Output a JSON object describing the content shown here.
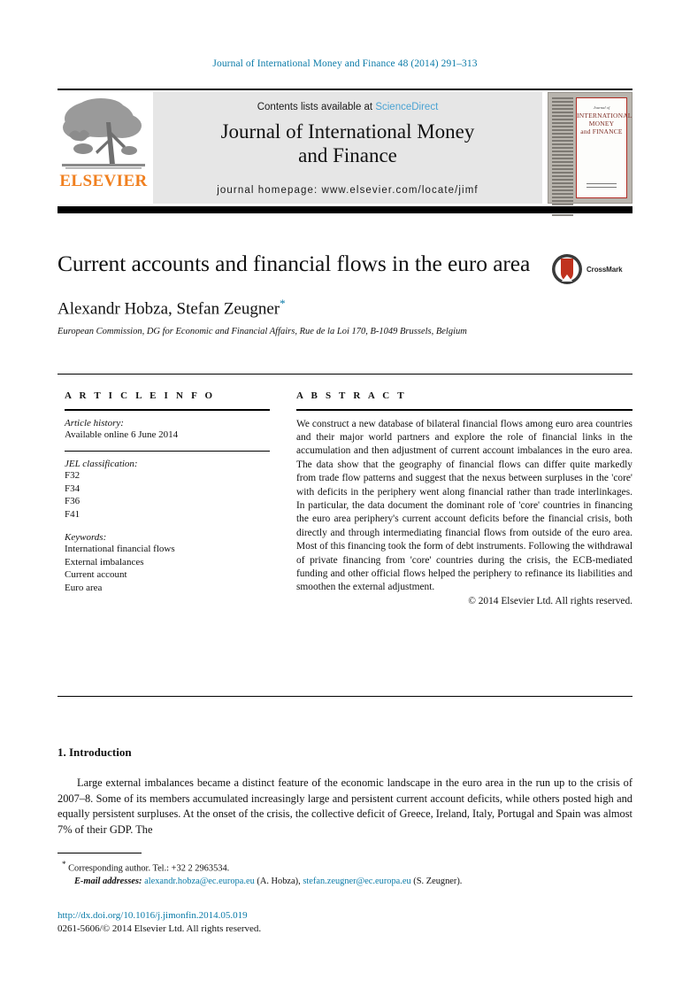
{
  "running_head": "Journal of International Money and Finance 48 (2014) 291–313",
  "masthead": {
    "publisher_name": "ELSEVIER",
    "publisher_logo": "elsevier-tree-logo",
    "contents_prefix": "Contents lists available at",
    "contents_link": "ScienceDirect",
    "journal_title_line1": "Journal of International Money",
    "journal_title_line2": "and Finance",
    "homepage_label": "journal homepage: www.elsevier.com/locate/jimf",
    "cover": {
      "kicker": "Journal of",
      "title_line1": "INTERNATIONAL",
      "title_line2": "MONEY",
      "title_line3": "and FINANCE"
    }
  },
  "article": {
    "title": "Current accounts and financial flows in the euro area",
    "crossmark_label": "CrossMark",
    "authors": "Alexandr Hobza, Stefan Zeugner",
    "corresponding_marker": "*",
    "affiliation": "European Commission, DG for Economic and Financial Affairs, Rue de la Loi 170, B-1049 Brussels, Belgium"
  },
  "article_info": {
    "heading": "A R T I C L E   I N F O",
    "history_label": "Article history:",
    "history_value": "Available online 6 June 2014",
    "jel_label": "JEL classification:",
    "jel_codes": [
      "F32",
      "F34",
      "F36",
      "F41"
    ],
    "keywords_label": "Keywords:",
    "keywords": [
      "International financial flows",
      "External imbalances",
      "Current account",
      "Euro area"
    ]
  },
  "abstract": {
    "heading": "A B S T R A C T",
    "text": "We construct a new database of bilateral financial flows among euro area countries and their major world partners and explore the role of financial links in the accumulation and then adjustment of current account imbalances in the euro area. The data show that the geography of financial flows can differ quite markedly from trade flow patterns and suggest that the nexus between surpluses in the 'core' with deficits in the periphery went along financial rather than trade interlinkages. In particular, the data document the dominant role of 'core' countries in financing the euro area periphery's current account deficits before the financial crisis, both directly and through intermediating financial flows from outside of the euro area. Most of this financing took the form of debt instruments. Following the withdrawal of private financing from 'core' countries during the crisis, the ECB-mediated funding and other official flows helped the periphery to refinance its liabilities and smoothen the external adjustment.",
    "copyright": "© 2014 Elsevier Ltd. All rights reserved."
  },
  "body": {
    "section_number_title": "1. Introduction",
    "paragraph": "Large external imbalances became a distinct feature of the economic landscape in the euro area in the run up to the crisis of 2007–8. Some of its members accumulated increasingly large and persistent current account deficits, while others posted high and equally persistent surpluses. At the onset of the crisis, the collective deficit of Greece, Ireland, Italy, Portugal and Spain was almost 7% of their GDP. The"
  },
  "footnotes": {
    "marker": "*",
    "corresponding": "Corresponding author. Tel.: +32 2 2963534.",
    "email_label": "E-mail addresses:",
    "email1": "alexandr.hobza@ec.europa.eu",
    "email1_owner": "(A. Hobza),",
    "email2": "stefan.zeugner@ec.europa.eu",
    "email2_owner": "(S. Zeugner)."
  },
  "footer": {
    "doi": "http://dx.doi.org/10.1016/j.jimonfin.2014.05.019",
    "issn_line": "0261-5606/© 2014 Elsevier Ltd. All rights reserved."
  },
  "colors": {
    "link": "#0b7ba8",
    "sciencedirect": "#4ba3d3",
    "elsevier_orange": "#f08020",
    "crossmark_red": "#c0321e"
  }
}
